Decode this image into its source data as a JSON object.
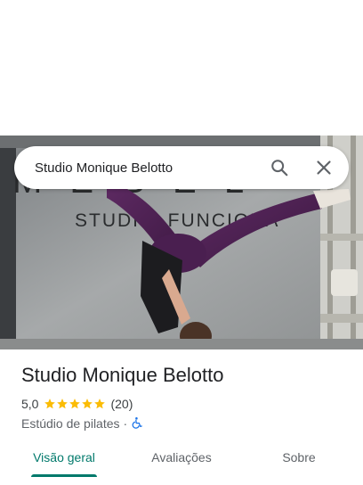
{
  "search": {
    "query": "Studio Monique Belotto",
    "search_icon": "search-icon",
    "close_icon": "close-icon"
  },
  "photo": {
    "wall_text_top": "M  E  B E L",
    "wall_text_bottom": "STUDI         S FUNCIONA"
  },
  "place": {
    "name": "Studio Monique Belotto",
    "rating": "5,0",
    "stars": 5,
    "reviews": "(20)",
    "category": "Estúdio de pilates",
    "separator": "·",
    "accessibility_icon": "wheelchair-icon"
  },
  "tabs": [
    {
      "label": "Visão geral",
      "active": true
    },
    {
      "label": "Avaliações",
      "active": false
    },
    {
      "label": "Sobre",
      "active": false
    }
  ],
  "colors": {
    "accent": "#00796b",
    "star": "#fbbc04",
    "accessibility": "#1a73e8"
  }
}
